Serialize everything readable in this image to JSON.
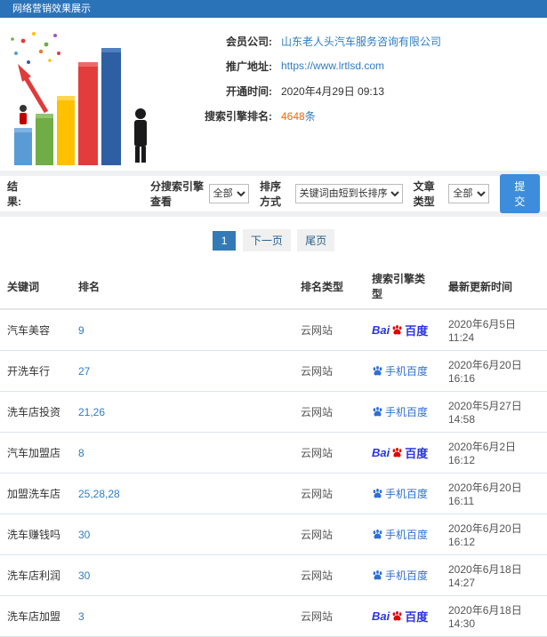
{
  "colors": {
    "header_bg": "#2b73b9",
    "link": "#2f7cc0",
    "highlight": "#ff6600",
    "baidu_blue": "#2932e1",
    "baidu_red": "#e10601",
    "mobile_blue": "#2f6fd3",
    "submit_bg": "#3e8ddd"
  },
  "header": {
    "title": "网络营销效果展示"
  },
  "summary": {
    "rows": [
      {
        "label": "会员公司:",
        "value": "山东老人头汽车服务咨询有限公司"
      },
      {
        "label": "推广地址:",
        "value": "https://www.lrtlsd.com"
      },
      {
        "label": "开通时间:",
        "value": "2020年4月29日 09:13"
      },
      {
        "label": "搜索引擎排名:",
        "value": "4648",
        "suffix": "条"
      }
    ]
  },
  "filters": {
    "section_label": "结果:",
    "engine": {
      "label": "分搜索引擎查看",
      "value": "全部"
    },
    "sort": {
      "label": "排序方式",
      "value": "关键词由短到长排序"
    },
    "article": {
      "label": "文章类型",
      "value": "全部"
    },
    "submit_label": "提交"
  },
  "pagination": {
    "current": "1",
    "next_label": "下一页",
    "last_label": "尾页"
  },
  "table": {
    "headers": [
      "关键词",
      "排名",
      "排名类型",
      "搜索引擎类型",
      "最新更新时间"
    ],
    "baidu_logo": {
      "bai": "Bai",
      "du": "百度"
    },
    "mobile_baidu_label": "手机百度",
    "rows": [
      {
        "keyword": "汽车美容",
        "rank": "9",
        "rank_type": "云网站",
        "engine": "pc",
        "updated": "2020年6月5日 11:24"
      },
      {
        "keyword": "开洗车行",
        "rank": "27",
        "rank_type": "云网站",
        "engine": "mobile",
        "updated": "2020年6月20日 16:16"
      },
      {
        "keyword": "洗车店投资",
        "rank": "21,26",
        "rank_type": "云网站",
        "engine": "mobile",
        "updated": "2020年5月27日 14:58"
      },
      {
        "keyword": "汽车加盟店",
        "rank": "8",
        "rank_type": "云网站",
        "engine": "pc",
        "updated": "2020年6月2日 16:12"
      },
      {
        "keyword": "加盟洗车店",
        "rank": "25,28,28",
        "rank_type": "云网站",
        "engine": "mobile",
        "updated": "2020年6月20日 16:11"
      },
      {
        "keyword": "洗车赚钱吗",
        "rank": "30",
        "rank_type": "云网站",
        "engine": "mobile",
        "updated": "2020年6月20日 16:12"
      },
      {
        "keyword": "洗车店利润",
        "rank": "30",
        "rank_type": "云网站",
        "engine": "mobile",
        "updated": "2020年6月18日 14:27"
      },
      {
        "keyword": "洗车店加盟",
        "rank": "3",
        "rank_type": "云网站",
        "engine": "pc",
        "updated": "2020年6月18日 14:30"
      }
    ]
  }
}
